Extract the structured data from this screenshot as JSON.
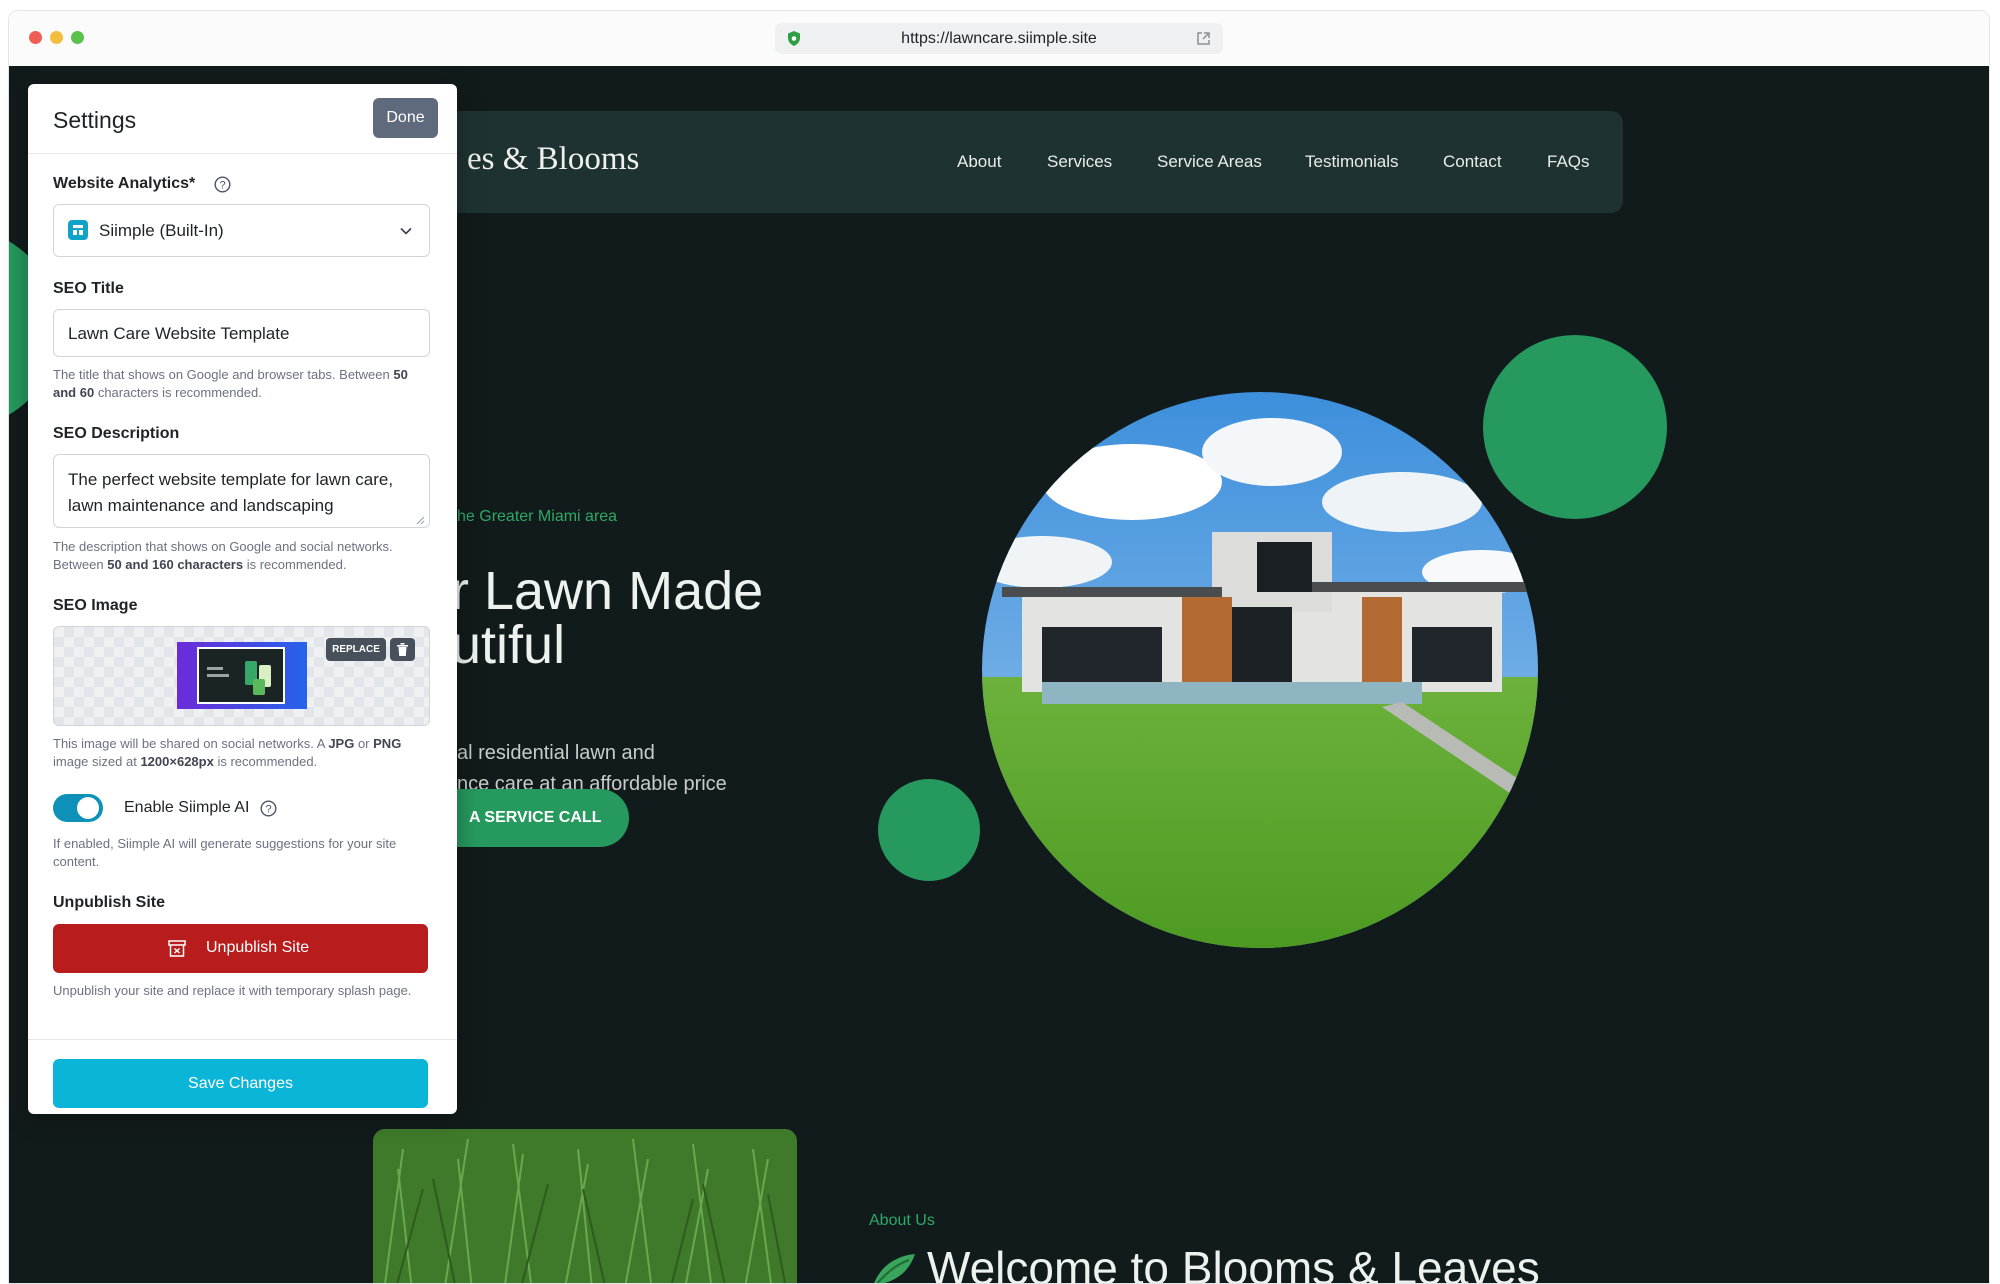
{
  "browser": {
    "url": "https://lawncare.siimple.site"
  },
  "site": {
    "brand_visible": "es & Blooms",
    "nav": [
      "About",
      "Services",
      "Service Areas",
      "Testimonials",
      "Contact",
      "FAQs"
    ],
    "hero": {
      "eyebrow": "he Greater Miami area",
      "title_line1": "r Lawn Made",
      "title_line2": "utiful",
      "subtitle_line1": "al residential lawn and",
      "subtitle_line2": "nce care at an affordable price",
      "cta": "A SERVICE CALL"
    },
    "about": {
      "eyebrow": "About Us",
      "title": "Welcome to Blooms & Leaves"
    }
  },
  "settings": {
    "title": "Settings",
    "done_label": "Done",
    "analytics": {
      "label": "Website Analytics*",
      "value": "Siimple (Built-In)"
    },
    "seo_title": {
      "label": "SEO Title",
      "value": "Lawn Care Website Template",
      "help_pre": "The title that shows on Google and browser tabs. Between",
      "help_bold": "50 and 60",
      "help_post": "characters is recommended."
    },
    "seo_description": {
      "label": "SEO Description",
      "value_line1": "The perfect website template for lawn care,",
      "value_line2": "lawn maintenance and landscaping",
      "help_pre": "The description that shows on Google and social networks. Between",
      "help_bold": "50 and 160 characters",
      "help_post": "is recommended."
    },
    "seo_image": {
      "label": "SEO Image",
      "replace_label": "REPLACE",
      "help_pre": "This image will be shared on social networks. A",
      "help_jpg": "JPG",
      "help_or": "or",
      "help_png": "PNG",
      "help_mid": "image sized at",
      "help_size": "1200×628px",
      "help_post": "is recommended."
    },
    "ai": {
      "label": "Enable Siimple AI",
      "enabled": true,
      "help": "If enabled, Siimple AI will generate suggestions for your site content."
    },
    "unpublish": {
      "label": "Unpublish Site",
      "button": "Unpublish Site",
      "help": "Unpublish your site and replace it with temporary splash page."
    },
    "save_label": "Save Changes"
  },
  "colors": {
    "page_bg": "#121b1c",
    "accent_green": "#269a5e",
    "save_button": "#0bb5d8",
    "danger": "#b91c1c",
    "toggle_on": "#0e91b9"
  }
}
